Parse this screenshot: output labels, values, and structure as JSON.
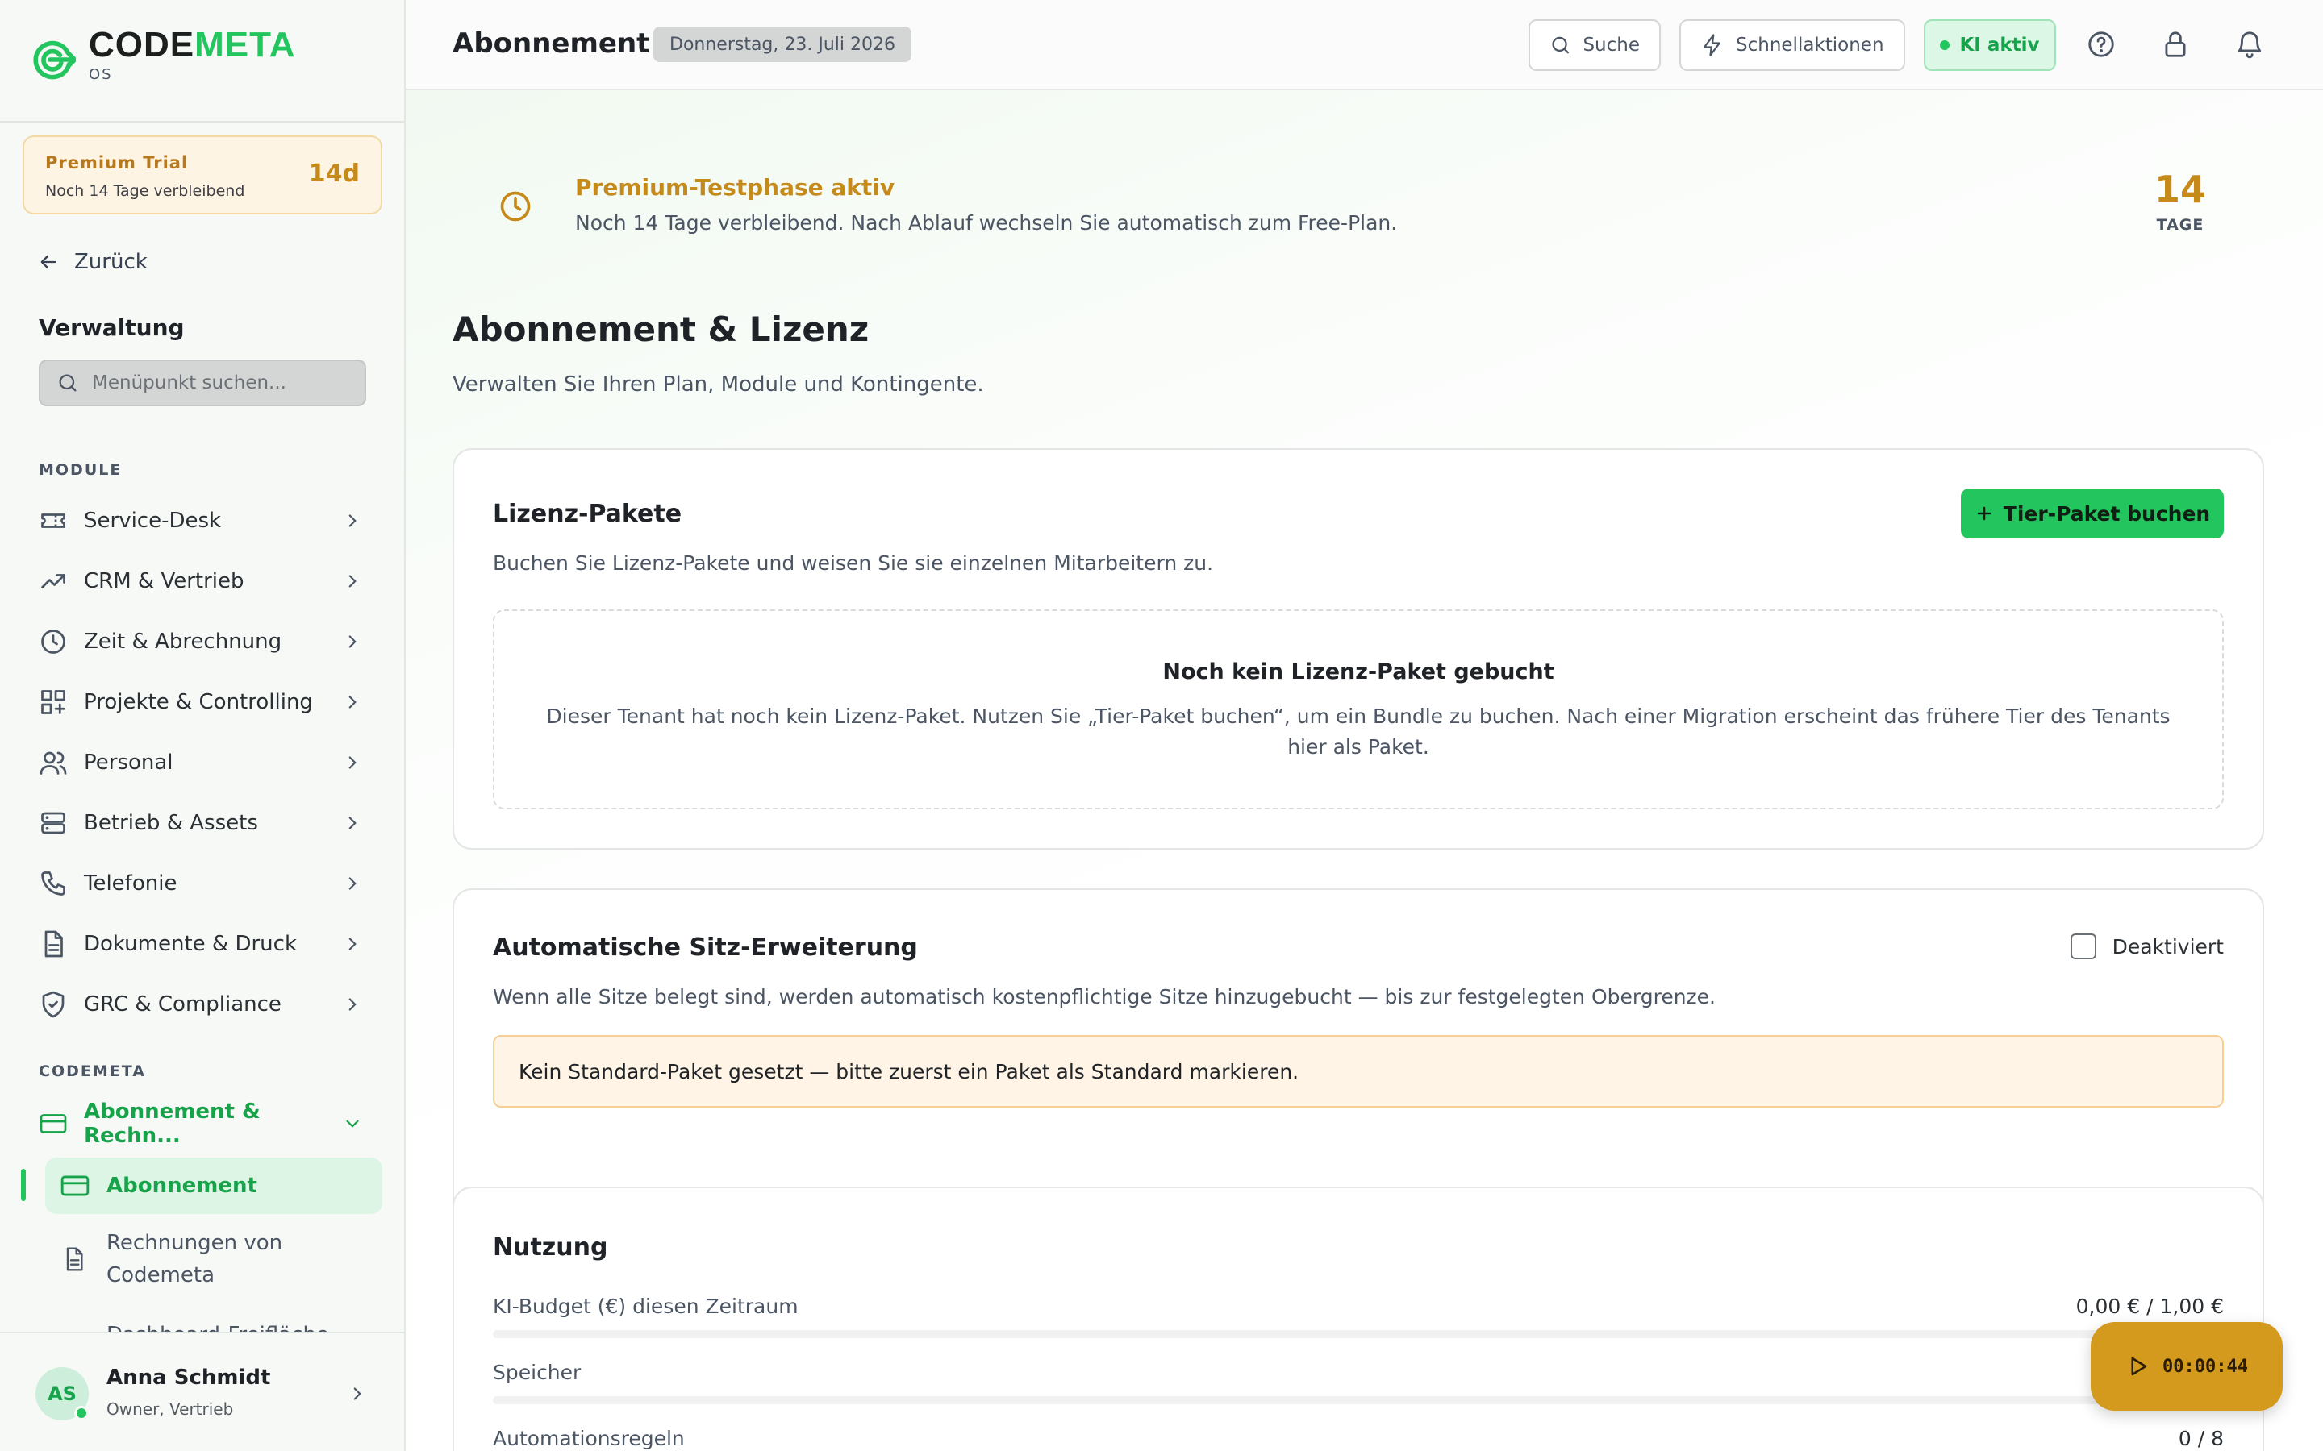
{
  "app": {
    "logo_part1": "CODE",
    "logo_part2": "META",
    "logo_sub": "OS",
    "brand_color": "#22c55e"
  },
  "sidebar": {
    "trial": {
      "title": "Premium Trial",
      "subtitle": "Noch 14 Tage verbleibend",
      "days": "14d"
    },
    "back_label": "Zurück",
    "section_title": "Verwaltung",
    "search_placeholder": "Menüpunkt suchen...",
    "group_modules": "MODULE",
    "modules": [
      {
        "label": "Service-Desk",
        "icon": "ticket-icon"
      },
      {
        "label": "CRM & Vertrieb",
        "icon": "trending-up-icon"
      },
      {
        "label": "Zeit & Abrechnung",
        "icon": "clock-icon"
      },
      {
        "label": "Projekte & Controlling",
        "icon": "grid-plus-icon"
      },
      {
        "label": "Personal",
        "icon": "users-icon"
      },
      {
        "label": "Betrieb & Assets",
        "icon": "server-icon"
      },
      {
        "label": "Telefonie",
        "icon": "phone-icon"
      },
      {
        "label": "Dokumente & Druck",
        "icon": "document-icon"
      },
      {
        "label": "GRC & Compliance",
        "icon": "shield-icon"
      }
    ],
    "group_codemeta": "CODEMETA",
    "codemeta_open": {
      "label": "Abonnement & Rechn...",
      "icon": "credit-card-icon"
    },
    "sub_active": "Abonnement",
    "sub_item": "Rechnungen von Codemeta",
    "sub_item_cut": "Dashboard-Freifläche",
    "user": {
      "initials": "AS",
      "name": "Anna Schmidt",
      "role": "Owner, Vertrieb"
    }
  },
  "header": {
    "title": "Abonnement",
    "date": "Donnerstag, 23. Juli 2026",
    "search_label": "Suche",
    "quick_label": "Schnellaktionen",
    "ki_label": "KI aktiv"
  },
  "banner": {
    "title": "Premium-Testphase aktiv",
    "text": "Noch 14 Tage verbleibend. Nach Ablauf wechseln Sie automatisch zum Free-Plan.",
    "days": "14",
    "unit": "TAGE"
  },
  "page": {
    "title": "Abonnement & Lizenz",
    "subtitle": "Verwalten Sie Ihren Plan, Module und Kontingente."
  },
  "licenses": {
    "title": "Lizenz-Pakete",
    "desc": "Buchen Sie Lizenz-Pakete und weisen Sie sie einzelnen Mitarbeitern zu.",
    "button": "Tier-Paket buchen",
    "empty_title": "Noch kein Lizenz-Paket gebucht",
    "empty_text": "Dieser Tenant hat noch kein Lizenz-Paket. Nutzen Sie „Tier-Paket buchen“, um ein Bundle zu buchen. Nach einer Migration erscheint das frühere Tier des Tenants hier als Paket."
  },
  "seats": {
    "title": "Automatische Sitz-Erweiterung",
    "toggle_label": "Deaktiviert",
    "desc": "Wenn alle Sitze belegt sind, werden automatisch kostenpflichtige Sitze hinzugebucht — bis zur festgelegten Obergrenze.",
    "warning": "Kein Standard-Paket gesetzt — bitte zuerst ein Paket als Standard markieren."
  },
  "usage": {
    "title": "Nutzung",
    "rows": [
      {
        "label": "KI-Budget (€) diesen Zeitraum",
        "value": "0,00 € / 1,00 €",
        "fraction": 0
      },
      {
        "label": "Speicher",
        "value": "",
        "fraction": 0
      },
      {
        "label": "Automationsregeln",
        "value": "0 / 8",
        "fraction": 0
      }
    ]
  },
  "timer": {
    "time": "00:00:44"
  }
}
